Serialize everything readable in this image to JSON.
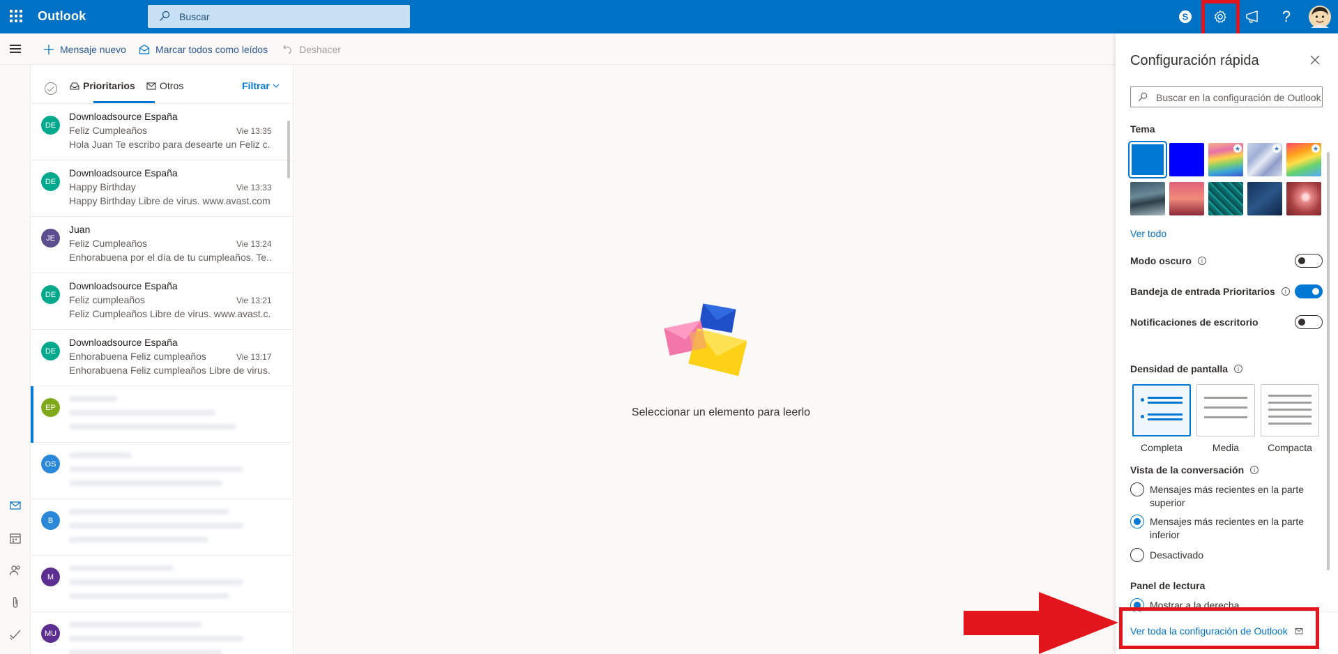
{
  "header": {
    "brand": "Outlook",
    "search_placeholder": "Buscar",
    "icons": [
      "waffle-icon",
      "search-icon",
      "skype-icon",
      "gear-icon",
      "megaphone-icon",
      "help-icon",
      "avatar"
    ],
    "help_glyph": "?",
    "accent_color": "#0072c6"
  },
  "commandbar": {
    "new_message": "Mensaje nuevo",
    "mark_all_read": "Marcar todos como leídos",
    "undo": "Deshacer"
  },
  "list": {
    "tab_focused": "Prioritarios",
    "tab_other": "Otros",
    "filter": "Filtrar",
    "messages": [
      {
        "initials": "DE",
        "color": "#00a88c",
        "from": "Downloadsource España",
        "subject": "Feliz Cumpleaños",
        "time": "Vie 13:35",
        "preview": "Hola Juan Te escribo para desearte un Feliz c..."
      },
      {
        "initials": "DE",
        "color": "#00a88c",
        "from": "Downloadsource España",
        "subject": "Happy Birthday",
        "time": "Vie 13:33",
        "preview": "Happy Birthday Libre de virus. www.avast.com"
      },
      {
        "initials": "JE",
        "color": "#5c4f8f",
        "from": "Juan",
        "subject": "Feliz Cumpleaños",
        "time": "Vie 13:24",
        "preview": "Enhorabuena por el día de tu cumpleaños. Te..."
      },
      {
        "initials": "DE",
        "color": "#00a88c",
        "from": "Downloadsource España",
        "subject": "Feliz cumpleaños",
        "time": "Vie 13:21",
        "preview": "Feliz Cumpleaños Libre de virus. www.avast.c..."
      },
      {
        "initials": "DE",
        "color": "#00a88c",
        "from": "Downloadsource España",
        "subject": "Enhorabuena Feliz cumpleaños",
        "time": "Vie 13:17",
        "preview": "Enhorabuena Feliz cumpleaños Libre de virus..."
      }
    ],
    "blurred_avatars": [
      {
        "initials": "EP",
        "color": "#7fa81a"
      },
      {
        "initials": "OS",
        "color": "#2b88d8"
      },
      {
        "initials": "B",
        "color": "#2b88d8"
      },
      {
        "initials": "M",
        "color": "#5c2e91"
      },
      {
        "initials": "MU",
        "color": "#5c2e91"
      }
    ]
  },
  "reading": {
    "empty_message": "Seleccionar un elemento para leerlo"
  },
  "quick_settings": {
    "title": "Configuración rápida",
    "search_placeholder": "Buscar en la configuración de Outlook",
    "theme_label": "Tema",
    "see_all": "Ver todo",
    "dark_mode": "Modo oscuro",
    "focused_inbox": "Bandeja de entrada Prioritarios",
    "desktop_notifications": "Notificaciones de escritorio",
    "density_label": "Densidad de pantalla",
    "density_options": [
      "Completa",
      "Media",
      "Compacta"
    ],
    "conversation_label": "Vista de la conversación",
    "conversation_options": [
      "Mensajes más recientes en la parte superior",
      "Mensajes más recientes en la parte inferior",
      "Desactivado"
    ],
    "conversation_selected_index": 1,
    "reading_pane_label": "Panel de lectura",
    "reading_pane_partial": "Mostrar a la derecha",
    "footer_link": "Ver toda la configuración de Outlook",
    "dark_mode_on": false,
    "focused_inbox_on": true,
    "notifications_on": false
  }
}
